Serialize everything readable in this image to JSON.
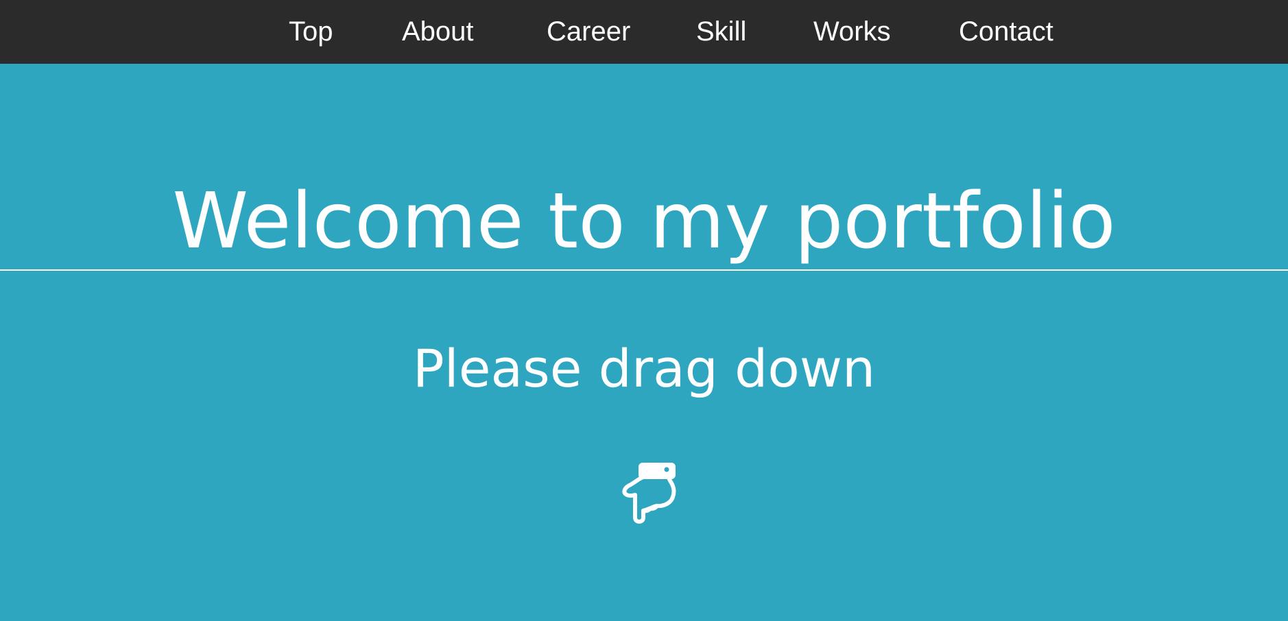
{
  "nav": {
    "items": [
      {
        "label": "Top"
      },
      {
        "label": "About"
      },
      {
        "label": "Career"
      },
      {
        "label": "Skill"
      },
      {
        "label": "Works"
      },
      {
        "label": "Contact"
      }
    ]
  },
  "hero": {
    "title": "Welcome to my portfolio",
    "subtitle": "Please drag down",
    "icon": "hand-pointing-down-icon"
  },
  "colors": {
    "nav_background": "#2b2b2b",
    "hero_background": "#2ea6bf",
    "text": "#ffffff"
  }
}
